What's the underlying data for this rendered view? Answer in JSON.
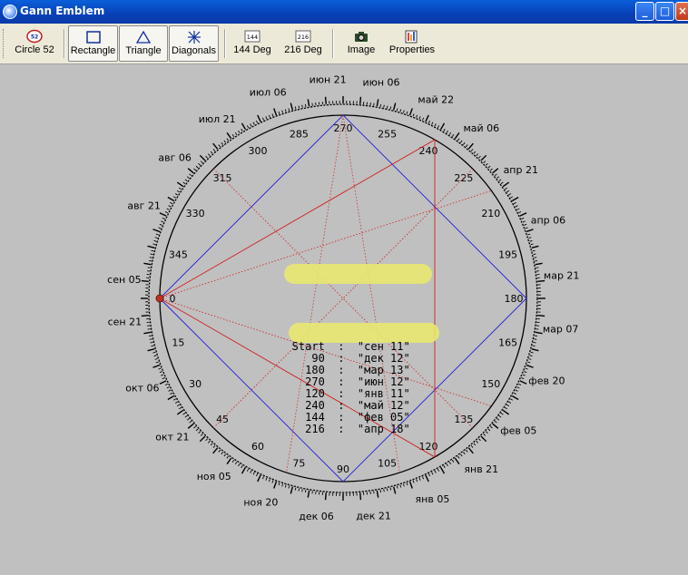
{
  "window": {
    "title": "Gann Emblem"
  },
  "toolbar": {
    "buttons": [
      {
        "id": "circle52",
        "label": "Circle 52",
        "icon": "circle52-icon",
        "pressed": false
      },
      {
        "id": "rectangle",
        "label": "Rectangle",
        "icon": "rectangle-icon",
        "pressed": true
      },
      {
        "id": "triangle",
        "label": "Triangle",
        "icon": "triangle-icon",
        "pressed": true
      },
      {
        "id": "diagonals",
        "label": "Diagonals",
        "icon": "diagonals-icon",
        "pressed": true
      },
      {
        "id": "deg144",
        "label": "144 Deg",
        "icon": "deg144-icon",
        "icon_text": "144",
        "pressed": false
      },
      {
        "id": "deg216",
        "label": "216 Deg",
        "icon": "deg216-icon",
        "icon_text": "216",
        "pressed": false
      },
      {
        "id": "image",
        "label": "Image",
        "icon": "camera-icon",
        "pressed": false
      },
      {
        "id": "properties",
        "label": "Properties",
        "icon": "properties-icon",
        "pressed": false
      }
    ]
  },
  "emblem": {
    "degree_labels": [
      {
        "deg": 0,
        "text": "0"
      },
      {
        "deg": 15,
        "text": "15"
      },
      {
        "deg": 30,
        "text": "30"
      },
      {
        "deg": 45,
        "text": "45"
      },
      {
        "deg": 60,
        "text": "60"
      },
      {
        "deg": 75,
        "text": "75"
      },
      {
        "deg": 90,
        "text": "90"
      },
      {
        "deg": 105,
        "text": "105"
      },
      {
        "deg": 120,
        "text": "120"
      },
      {
        "deg": 135,
        "text": "135"
      },
      {
        "deg": 150,
        "text": "150"
      },
      {
        "deg": 165,
        "text": "165"
      },
      {
        "deg": 180,
        "text": "180"
      },
      {
        "deg": 195,
        "text": "195"
      },
      {
        "deg": 210,
        "text": "210"
      },
      {
        "deg": 225,
        "text": "225"
      },
      {
        "deg": 240,
        "text": "240"
      },
      {
        "deg": 255,
        "text": "255"
      },
      {
        "deg": 270,
        "text": "270"
      },
      {
        "deg": 285,
        "text": "285"
      },
      {
        "deg": 300,
        "text": "300"
      },
      {
        "deg": 315,
        "text": "315"
      },
      {
        "deg": 330,
        "text": "330"
      },
      {
        "deg": 345,
        "text": "345"
      }
    ],
    "date_labels": [
      {
        "deg": 355,
        "text": "сен 05"
      },
      {
        "deg": 6,
        "text": "сен 21"
      },
      {
        "deg": 24,
        "text": "окт 06"
      },
      {
        "deg": 39,
        "text": "окт 21"
      },
      {
        "deg": 54,
        "text": "ноя 05"
      },
      {
        "deg": 68,
        "text": "ноя 20"
      },
      {
        "deg": 83,
        "text": "дек 06"
      },
      {
        "deg": 98,
        "text": "дек 21"
      },
      {
        "deg": 114,
        "text": "янв 05"
      },
      {
        "deg": 129,
        "text": "янв 21"
      },
      {
        "deg": 143,
        "text": "фев 05"
      },
      {
        "deg": 158,
        "text": "фев 20"
      },
      {
        "deg": 172,
        "text": "мар 07"
      },
      {
        "deg": 186,
        "text": "мар 21"
      },
      {
        "deg": 201,
        "text": "апр 06"
      },
      {
        "deg": 216,
        "text": "апр 21"
      },
      {
        "deg": 231,
        "text": "май 06"
      },
      {
        "deg": 245,
        "text": "май 22"
      },
      {
        "deg": 260,
        "text": "июн 06"
      },
      {
        "deg": 274,
        "text": "июн 21"
      },
      {
        "deg": 290,
        "text": "июл 06"
      },
      {
        "deg": 305,
        "text": "июл 21"
      },
      {
        "deg": 320,
        "text": "авг 06"
      },
      {
        "deg": 335,
        "text": "авг 21"
      }
    ],
    "square_start_deg": 0,
    "triangle_start_deg": 0,
    "diagonal_degs": [
      45,
      135
    ],
    "line_colors": {
      "square": "#2020d0",
      "triangle": "#d02020",
      "diagonal": "#d03030",
      "ring": "#000000"
    },
    "start_marker_color": "#c03020",
    "highlight_color": "#e8e870"
  },
  "info_table": [
    {
      "deg": "Start",
      "date": "\"сен 11\"",
      "highlight": true
    },
    {
      "deg": "90",
      "date": "\"дек 12\"",
      "highlight": false
    },
    {
      "deg": "180",
      "date": "\"мар 13\"",
      "highlight": false
    },
    {
      "deg": "270",
      "date": "\"июн 12\"",
      "highlight": false
    },
    {
      "deg": "120",
      "date": "\"янв 11\"",
      "highlight": false
    },
    {
      "deg": "240",
      "date": "\"май 12\"",
      "highlight": true
    },
    {
      "deg": "144",
      "date": "\"фев 05\"",
      "highlight": false
    },
    {
      "deg": "216",
      "date": "\"апр 18\"",
      "highlight": false
    }
  ]
}
